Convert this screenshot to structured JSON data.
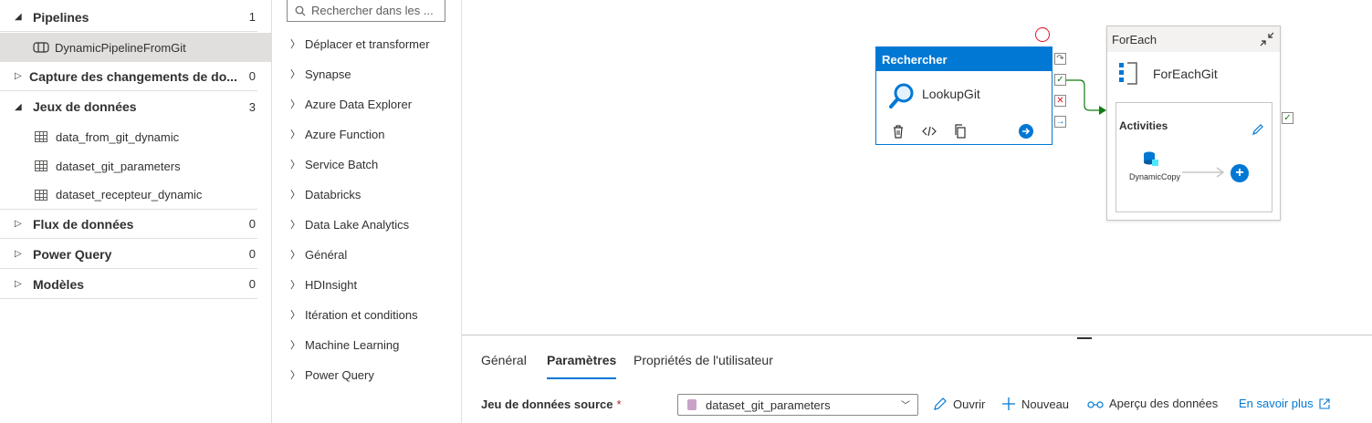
{
  "tree": {
    "pipelines": {
      "label": "Pipelines",
      "count": "1"
    },
    "pipeline_item": "DynamicPipelineFromGit",
    "cdc": {
      "label": "Capture des changements de do...",
      "count": "0"
    },
    "datasets": {
      "label": "Jeux de données",
      "count": "3"
    },
    "dataset_items": [
      "data_from_git_dynamic",
      "dataset_git_parameters",
      "dataset_recepteur_dynamic"
    ],
    "dataflows": {
      "label": "Flux de données",
      "count": "0"
    },
    "powerquery": {
      "label": "Power Query",
      "count": "0"
    },
    "templates": {
      "label": "Modèles",
      "count": "0"
    }
  },
  "activities": {
    "search_placeholder": "Rechercher dans les ...",
    "groups": [
      "Déplacer et transformer",
      "Synapse",
      "Azure Data Explorer",
      "Azure Function",
      "Service Batch",
      "Databricks",
      "Data Lake Analytics",
      "Général",
      "HDInsight",
      "Itération et conditions",
      "Machine Learning",
      "Power Query"
    ]
  },
  "canvas": {
    "lookup": {
      "type": "Rechercher",
      "name": "LookupGit"
    },
    "foreach": {
      "type": "ForEach",
      "name": "ForEachGit",
      "inner_title": "Activities",
      "inner_activity": "DynamicCopy"
    }
  },
  "bottom": {
    "tabs": [
      "Général",
      "Paramètres",
      "Propriétés de l'utilisateur"
    ],
    "source_label": "Jeu de données source",
    "required_mark": "*",
    "source_value": "dataset_git_parameters",
    "open": "Ouvrir",
    "new": "Nouveau",
    "preview": "Aperçu des données",
    "learn_more": "En savoir plus"
  },
  "colors": {
    "accent": "#0078d4",
    "success": "#107c10",
    "error": "#e81123"
  }
}
